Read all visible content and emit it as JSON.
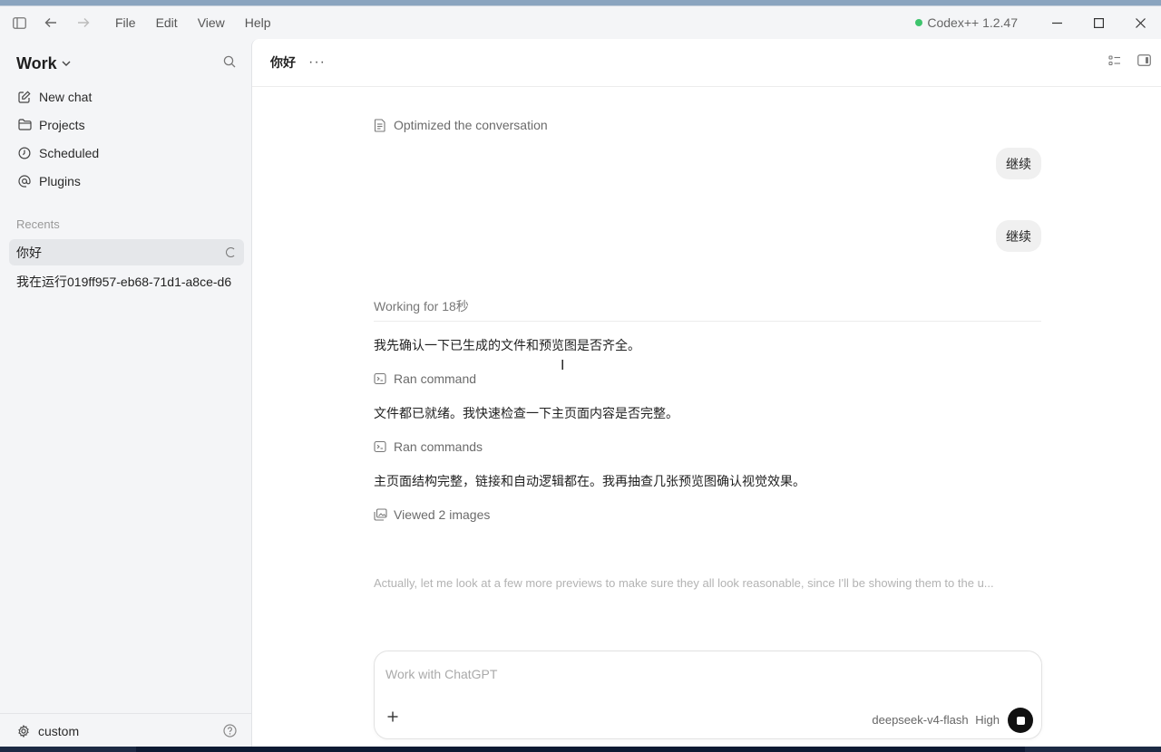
{
  "titlebar": {
    "menu": [
      "File",
      "Edit",
      "View",
      "Help"
    ],
    "app_status": "Codex++ 1.2.47",
    "status_color": "#3ec46d"
  },
  "sidebar": {
    "workspace": "Work",
    "nav": [
      {
        "label": "New chat",
        "icon": "edit-icon"
      },
      {
        "label": "Projects",
        "icon": "folder-icon"
      },
      {
        "label": "Scheduled",
        "icon": "clock-icon"
      },
      {
        "label": "Plugins",
        "icon": "at-icon"
      }
    ],
    "recents_label": "Recents",
    "recents": [
      {
        "label": "你好",
        "active": true
      },
      {
        "label": "我在运行019ff957-eb68-71d1-a8ce-d6",
        "active": false
      }
    ],
    "settings_label": "custom"
  },
  "header": {
    "chat_title": "你好",
    "more": "···"
  },
  "conversation": {
    "optimized": "Optimized the conversation",
    "user_messages": [
      "继续",
      "继续"
    ],
    "working": "Working for 18秒",
    "msg1": "我先确认一下已生成的文件和预览图是否齐全。",
    "tool1": "Ran command",
    "msg2": "文件都已就绪。我快速检查一下主页面内容是否完整。",
    "tool2": "Ran commands",
    "msg3": "主页面结构完整，链接和自动逻辑都在。我再抽查几张预览图确认视觉效果。",
    "tool3": "Viewed 2 images",
    "thinking": "Actually, let me look at a few more previews to make sure they all look reasonable, since I'll be showing them to the u..."
  },
  "composer": {
    "placeholder": "Work with ChatGPT",
    "model": "deepseek-v4-flash",
    "effort": "High"
  }
}
